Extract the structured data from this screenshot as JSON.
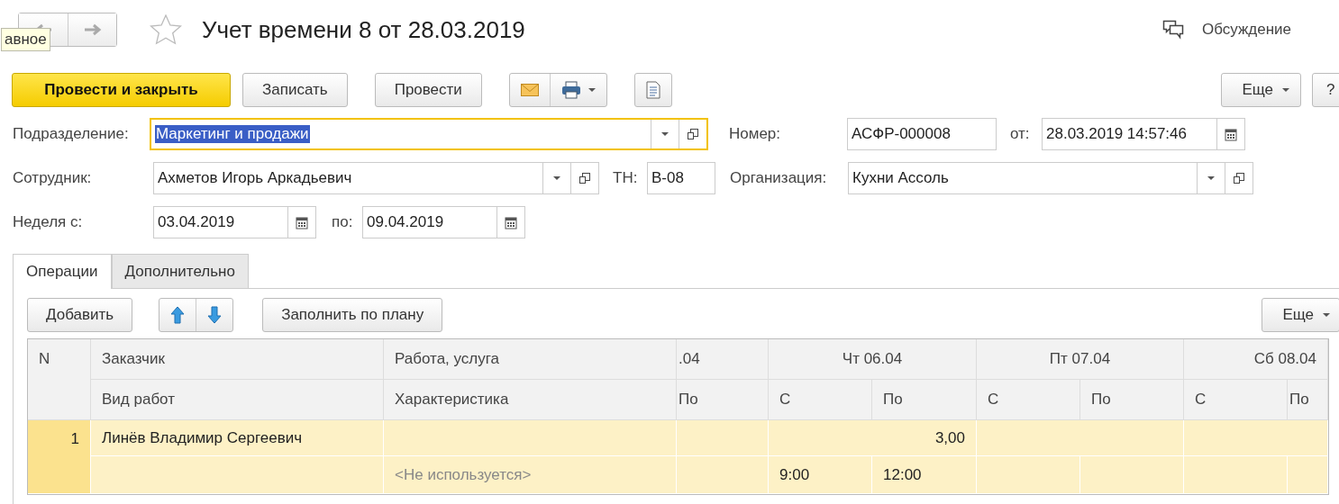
{
  "nav": {
    "tooltip": "авное"
  },
  "title": "Учет времени 8 от 28.03.2019",
  "favorite": false,
  "discussion": "Обсуждение",
  "toolbar": {
    "buttons": [
      {
        "label": "Провести и закрыть",
        "kind": "primary"
      },
      {
        "label": "Записать",
        "kind": "plain"
      },
      {
        "label": "Провести",
        "kind": "plain"
      }
    ],
    "more": "Еще",
    "help": "?"
  },
  "form": {
    "department": {
      "label": "Подразделение:",
      "value": "Маркетинг и продажи",
      "focused": true
    },
    "number": {
      "label": "Номер:",
      "value": "АСФР-000008"
    },
    "date": {
      "label": "от:",
      "value": "28.03.2019 14:57:46"
    },
    "employee": {
      "label": "Сотрудник:",
      "value": "Ахметов Игорь Аркадьевич"
    },
    "tab_number": {
      "label": "ТН:",
      "value": "В-08"
    },
    "organization": {
      "label": "Организация:",
      "value": "Кухни Ассоль"
    },
    "week_from": {
      "label": "Неделя с:",
      "value": "03.04.2019"
    },
    "week_to": {
      "label": "по:",
      "value": "09.04.2019"
    }
  },
  "tabs": [
    {
      "label": "Операции",
      "selected": true
    },
    {
      "label": "Дополнительно",
      "selected": false
    }
  ],
  "table_toolbar": {
    "add": "Добавить",
    "fill": "Заполнить по плану",
    "more": "Еще"
  },
  "table": {
    "columns": {
      "number": "N",
      "customer": "Заказчик",
      "work": "Работа, услуга",
      "work_kind": "Вид работ",
      "characteristic": "Характеристика"
    },
    "days": [
      {
        "label": ".04",
        "kind": "partial",
        "to_label": "По"
      },
      {
        "label": "Чт 06.04",
        "kind": "full",
        "from_label": "С",
        "to_label": "По"
      },
      {
        "label": "Пт 07.04",
        "kind": "full",
        "from_label": "С",
        "to_label": "По"
      },
      {
        "label": "Сб 08.04",
        "kind": "full",
        "from_label": "С",
        "to_label": "По"
      }
    ],
    "rows": [
      {
        "number": "1",
        "selected": true,
        "customer": "Линёв Владимир Сергеевич",
        "characteristic": {
          "text": "<Не используется>",
          "disabled": true
        },
        "days": [
          {
            "kind": "empty"
          },
          {
            "kind": "filled",
            "hours": "3,00",
            "from": "9:00",
            "to": "12:00"
          },
          {
            "kind": "empty"
          },
          {
            "kind": "empty"
          }
        ]
      }
    ]
  }
}
